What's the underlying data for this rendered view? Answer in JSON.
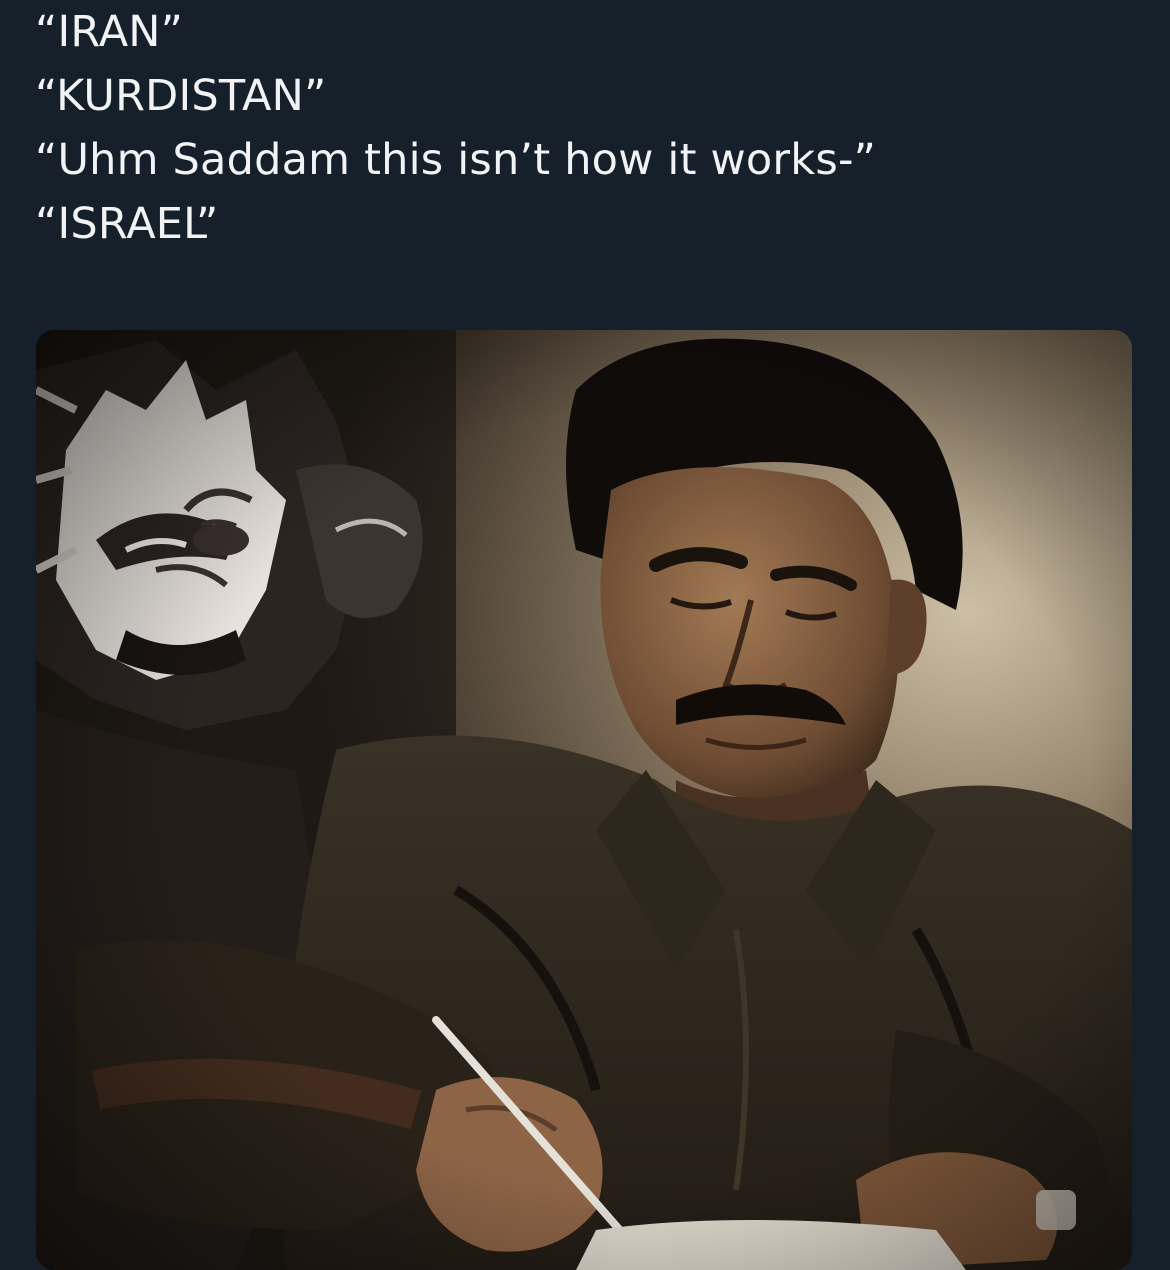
{
  "post": {
    "lines": [
      "“IRAN”",
      "“KURDISTAN”",
      "“Uhm Saddam this isn’t how it works-”",
      "“ISRAEL”"
    ]
  },
  "colors": {
    "background": "#16202b",
    "text": "#f1f3f5"
  }
}
